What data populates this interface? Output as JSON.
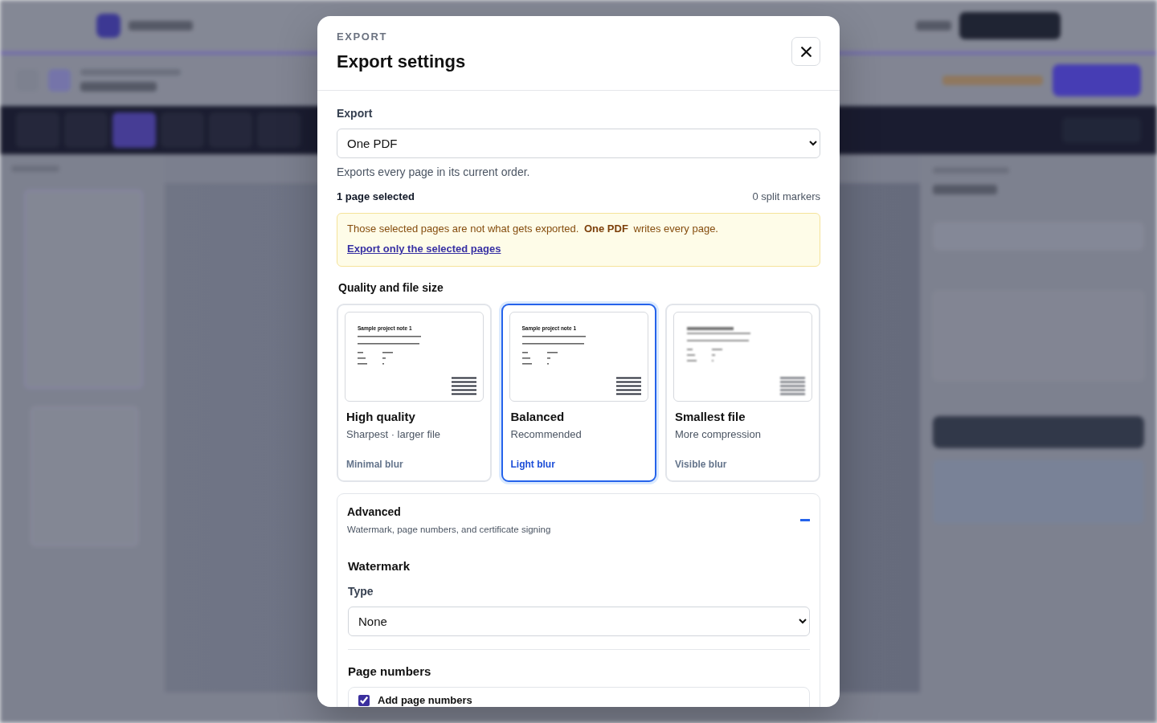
{
  "dialog": {
    "eyebrow": "EXPORT",
    "title": "Export settings"
  },
  "export": {
    "label": "Export",
    "value": "One PDF",
    "help": "Exports every page in its current order."
  },
  "selection": {
    "count": "1 page selected",
    "markers": "0 split markers"
  },
  "notice": {
    "message": "Those selected pages are not what gets exported. **One PDF** writes every page.",
    "link": "Export only the selected pages"
  },
  "quality": {
    "heading": "Quality and file size",
    "options": [
      {
        "title": "High quality",
        "subtitle": "Sharpest · larger file",
        "blur_label": "Minimal blur",
        "selected": false,
        "preview": {
          "blurred": false,
          "title": "Sample project note 1"
        }
      },
      {
        "title": "Balanced",
        "subtitle": "Recommended",
        "blur_label": "Light blur",
        "selected": true,
        "preview": {
          "blurred": false,
          "title": "Sample project note 1"
        }
      },
      {
        "title": "Smallest file",
        "subtitle": "More compression",
        "blur_label": "Visible blur",
        "selected": false,
        "preview": {
          "blurred": true
        }
      }
    ]
  },
  "advanced": {
    "title": "Advanced",
    "subtitle": "Watermark, page numbers, and certificate signing",
    "expanded": true,
    "watermark": {
      "heading": "Watermark",
      "type_label": "Type",
      "type_value": "None"
    },
    "page_numbers": {
      "heading": "Page numbers",
      "add_label": "Add page numbers",
      "checked": true
    }
  }
}
